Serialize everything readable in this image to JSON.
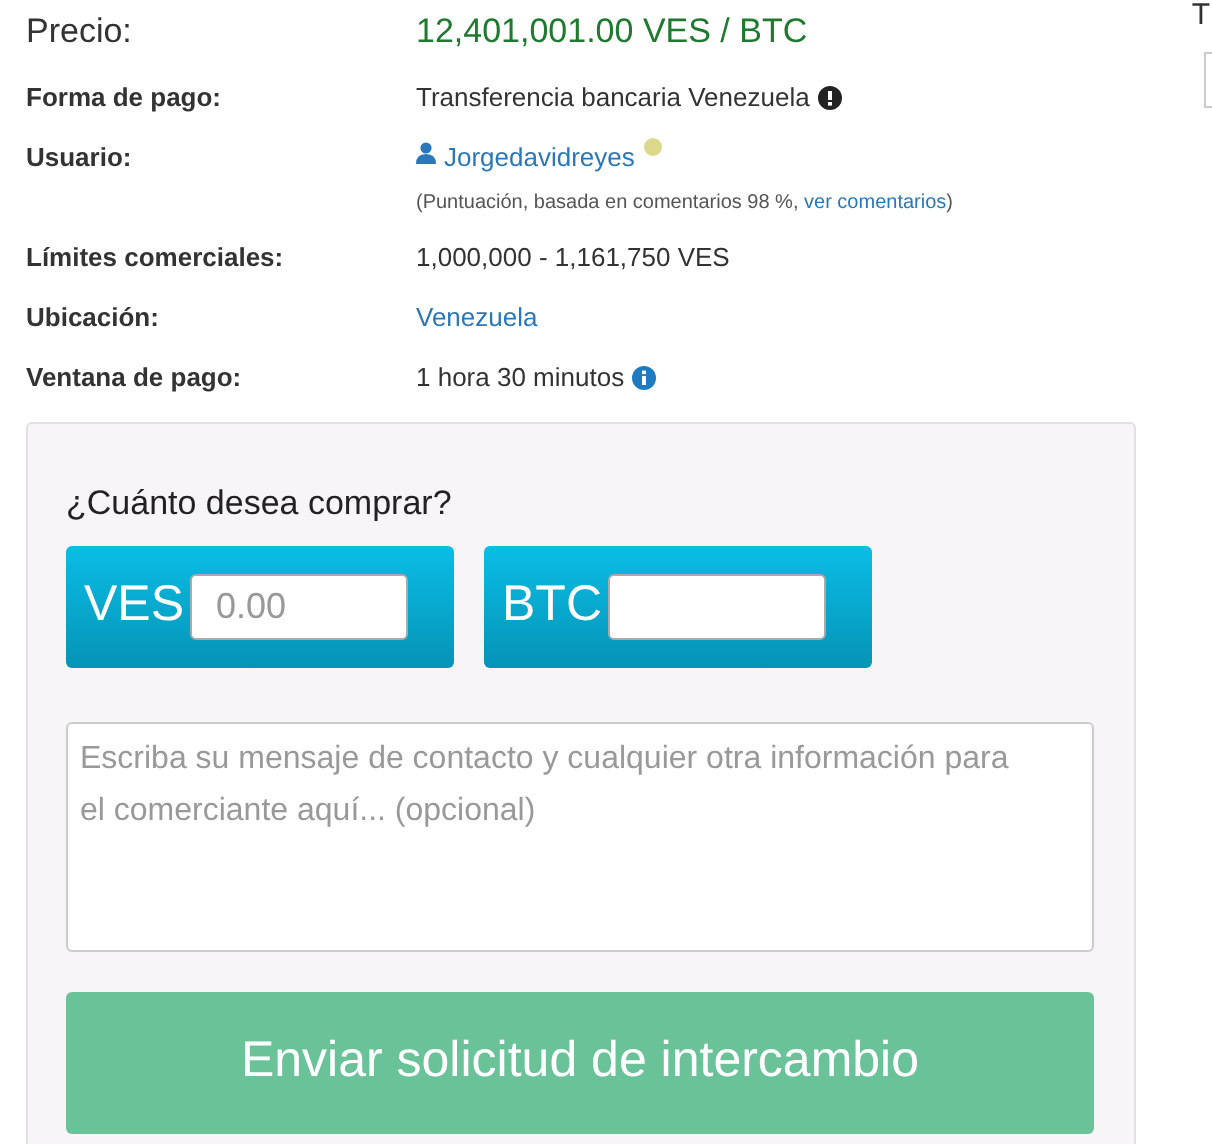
{
  "details": [
    {
      "label": "Precio:",
      "kind": "price",
      "value": "12,401,001.00 VES / BTC"
    },
    {
      "label": "Forma de pago:",
      "kind": "text-warning",
      "value": "Transferencia bancaria Venezuela"
    },
    {
      "label": "Usuario:",
      "kind": "user",
      "value": "Jorgedavidreyes",
      "rating_prefix": "(Puntuación, basada en comentarios 98 %, ",
      "rating_link": "ver comentarios",
      "rating_suffix": ")"
    },
    {
      "label": "Límites comerciales:",
      "kind": "text",
      "value": "1,000,000 - 1,161,750 VES"
    },
    {
      "label": "Ubicación:",
      "kind": "link",
      "value": "Venezuela"
    },
    {
      "label": "Ventana de pago:",
      "kind": "text-info",
      "value": "1 hora 30 minutos"
    }
  ],
  "form": {
    "question": "¿Cuánto desea comprar?",
    "amounts": [
      {
        "currency": "VES",
        "placeholder": "0.00"
      },
      {
        "currency": "BTC"
      }
    ],
    "message_placeholder": "Escriba su mensaje de contacto y cualquier otra información para el comerciante aquí... (opcional)",
    "submit": "Enviar solicitud de intercambio"
  },
  "right_edge": {
    "text": "T"
  }
}
